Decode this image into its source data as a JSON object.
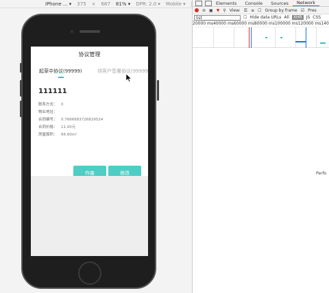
{
  "device_toolbar": {
    "device": "iPhone ... ▾",
    "width": "375",
    "x": "×",
    "height": "667",
    "zoom": "81% ▾",
    "dpr": "DPR: 2.0 ▾",
    "mode": "Mobile ▾"
  },
  "app": {
    "title": "协议管理",
    "tabs": [
      {
        "label": "起草中协议(99999)"
      },
      {
        "label": "待客户签署协议(99999"
      }
    ],
    "contract": {
      "title": "111111",
      "fields": [
        {
          "label": "联系方式：",
          "value": "0"
        },
        {
          "label": "物业地址：",
          "value": ""
        },
        {
          "label": "合同编号：",
          "value": "0.7666683726829524"
        },
        {
          "label": "合同价格：",
          "value": "11.00元"
        },
        {
          "label": "房屋面积：",
          "value": "66.60m²"
        }
      ]
    },
    "buttons": {
      "edit": "作废",
      "modify": "修改"
    }
  },
  "devtools": {
    "tabs": [
      "Elements",
      "Console",
      "Sources",
      "Network"
    ],
    "active_tab": "Network",
    "view_label": "View:",
    "group_by_frame": "Group by frame",
    "preserve": "Pres",
    "filter_value": "list",
    "hide_data_urls": "Hide data URLs",
    "filter_types": [
      "All",
      "XHR",
      "JS",
      "CSS"
    ],
    "ticks": "20000 ms40000 ms60000 ms80000 ms100000 ms120000 ms140000",
    "perf_label": "Perfo"
  }
}
